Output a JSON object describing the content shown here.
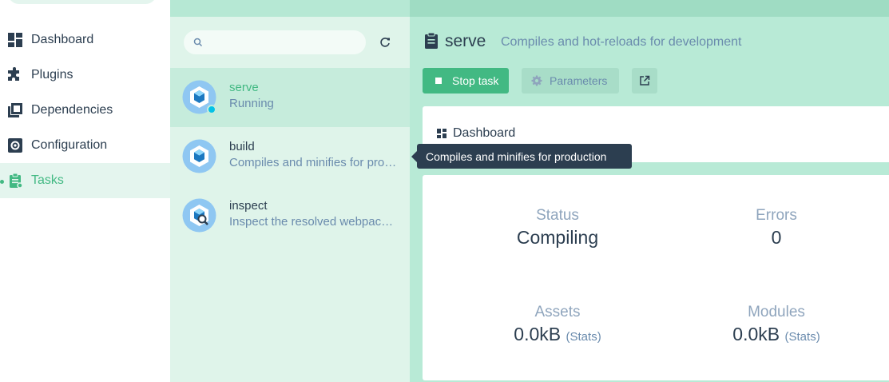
{
  "colors": {
    "accent": "#42b983",
    "sidebar_active_bg": "#e4f5ee",
    "tasks_bg": "#dff4ea",
    "detail_bg": "#b6e8d4",
    "tooltip_bg": "#2c3e50"
  },
  "sidebar": {
    "items": [
      {
        "label": "Dashboard",
        "icon": "dashboard-icon",
        "active": false
      },
      {
        "label": "Plugins",
        "icon": "puzzle-icon",
        "active": false
      },
      {
        "label": "Dependencies",
        "icon": "library-books-icon",
        "active": false
      },
      {
        "label": "Configuration",
        "icon": "gear-icon",
        "active": false
      },
      {
        "label": "Tasks",
        "icon": "clipboard-icon",
        "active": true
      }
    ]
  },
  "tasks": {
    "search": {
      "placeholder": "",
      "value": ""
    },
    "refresh_icon": "refresh-icon",
    "items": [
      {
        "name": "serve",
        "description": "Running",
        "selected": true,
        "status": "running"
      },
      {
        "name": "build",
        "description": "Compiles and minifies for production",
        "selected": false
      },
      {
        "name": "inspect",
        "description": "Inspect the resolved webpack config",
        "selected": false
      }
    ]
  },
  "detail": {
    "title": "serve",
    "subtitle": "Compiles and hot-reloads for development",
    "stop_label": "Stop task",
    "params_label": "Parameters",
    "dashboard_label": "Dashboard",
    "stats": {
      "status_label": "Status",
      "status_value": "Compiling",
      "errors_label": "Errors",
      "errors_value": "0",
      "assets_label": "Assets",
      "assets_value": "0.0kB",
      "assets_extra": "(Stats)",
      "modules_label": "Modules",
      "modules_value": "0.0kB",
      "modules_extra": "(Stats)"
    }
  },
  "tooltip": {
    "text": "Compiles and minifies for production"
  }
}
